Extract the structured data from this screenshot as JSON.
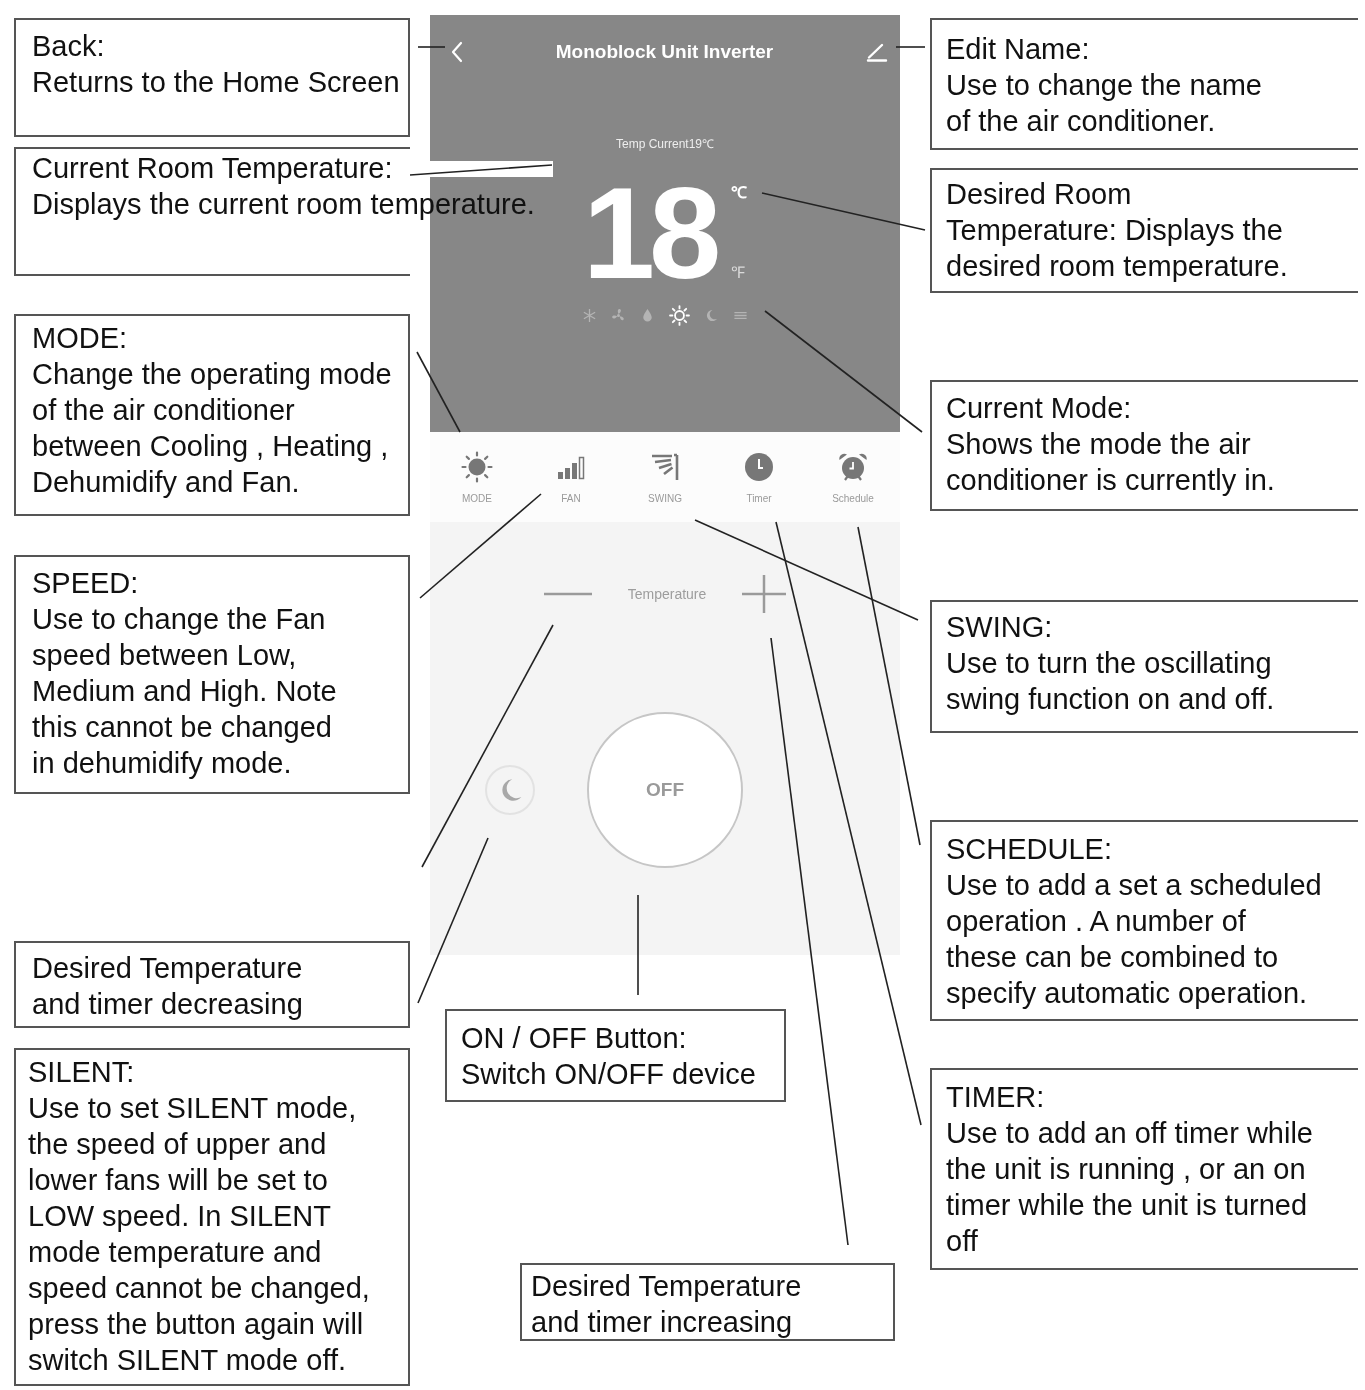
{
  "app_screen": {
    "header": {
      "title": "Monoblock Unit Inverter"
    },
    "current_temperature": "Temp Current19℃",
    "set_temperature": "18",
    "units": [
      {
        "label": "℃",
        "selected": true
      },
      {
        "label": "℉",
        "selected": false
      }
    ],
    "modes": [
      {
        "kind": "cool",
        "selected": false
      },
      {
        "kind": "fan",
        "selected": false
      },
      {
        "kind": "dry",
        "selected": false
      },
      {
        "kind": "heat",
        "selected": true
      },
      {
        "kind": "sleep",
        "selected": false
      },
      {
        "kind": "auto",
        "selected": false
      }
    ],
    "toolbar": [
      {
        "kind": "mode",
        "label": "MODE"
      },
      {
        "kind": "fan",
        "label": "FAN"
      },
      {
        "kind": "swing",
        "label": "SWING"
      },
      {
        "kind": "timer",
        "label": "Timer"
      },
      {
        "kind": "schedule",
        "label": "Schedule"
      }
    ],
    "temperature_control": {
      "label": "Temperature"
    },
    "power_button": {
      "label": "OFF"
    }
  },
  "callouts": [
    {
      "title": "Back:",
      "lines": [
        "Returns to the Home Screen"
      ]
    },
    {
      "title": "Current Room Temperature:",
      "lines": [
        "Displays the current room temperature."
      ]
    },
    {
      "title": "MODE:",
      "lines": [
        "Change the operating mode",
        "of the air conditioner",
        "between Cooling , Heating ,",
        "Dehumidify and Fan."
      ]
    },
    {
      "title": "SPEED:",
      "lines": [
        "Use to change the Fan",
        "speed between Low,",
        "Medium and High. Note",
        "this cannot be changed",
        "in dehumidify mode."
      ]
    },
    {
      "lines": [
        "Desired Temperature",
        "and timer decreasing"
      ]
    },
    {
      "title": "SILENT:",
      "lines": [
        "Use to set SILENT mode,",
        "the speed of upper and",
        "lower fans will be set to",
        "LOW speed. In SILENT",
        "mode temperature and",
        "speed cannot be changed,",
        "press the button again will",
        "switch SILENT mode off."
      ]
    },
    {
      "title": "ON / OFF Button:",
      "lines": [
        "Switch ON/OFF device"
      ]
    },
    {
      "lines": [
        "Desired Temperature",
        "and timer increasing"
      ]
    },
    {
      "title": "Edit Name:",
      "lines": [
        "Use to change the name",
        "of the air conditioner."
      ]
    },
    {
      "lines": [
        "Desired Room",
        "Temperature: Displays the",
        "desired room temperature."
      ]
    },
    {
      "title": "Current Mode:",
      "lines": [
        "Shows the mode the air",
        "conditioner is currently in."
      ]
    },
    {
      "title": "SWING:",
      "lines": [
        "Use to turn the oscillating",
        "swing function on and off."
      ]
    },
    {
      "title": "SCHEDULE:",
      "lines": [
        "Use to add a set a scheduled",
        "operation . A number of",
        "these can be combined to",
        "specify automatic operation."
      ]
    },
    {
      "title": "TIMER:",
      "lines": [
        "Use to add an off timer while",
        "the unit is running , or an on",
        "timer while the unit is turned",
        "off"
      ]
    }
  ]
}
